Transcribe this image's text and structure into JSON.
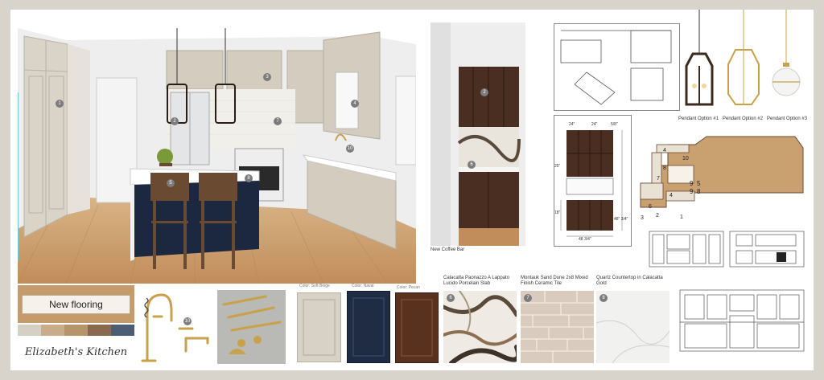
{
  "flooring_label": "New flooring",
  "signature": "Elizabeth's Kitchen",
  "coffee_bar_caption": "New Coffee Bar",
  "pendants": {
    "option1": "Pendant Option #1",
    "option2": "Pendant Option #2",
    "option3": "Pendant Option #3"
  },
  "color_labels": {
    "soft_beige": "Color: Soft Beige",
    "naval": "Color: Naval",
    "pecan": "Color: Pecan"
  },
  "materials": {
    "slab": "Calacatta Paonazzo A Lappato Lucido Porcelain Slab",
    "tile": "Montauk Sand Dune 2x8 Mixed Finish Ceramic Tile",
    "quartz": "Quartz Countertop in Calacatta Gold"
  },
  "callouts": {
    "c1": "1",
    "c2": "2",
    "c3": "3",
    "c4": "4",
    "c5": "5",
    "c6": "6",
    "c7": "7",
    "c8": "8",
    "c9": "9",
    "c10": "10",
    "s10": "10",
    "s6": "6",
    "s7": "7",
    "s8": "8",
    "cb2": "2",
    "cb6": "6"
  },
  "plan_numbers": {
    "n4a": "4",
    "n10": "10",
    "n8": "8",
    "n7": "7",
    "n4b": "4",
    "n9a": "9",
    "n5": "5",
    "n9b": "9",
    "n8b": "8",
    "n6": "6",
    "n2": "2",
    "n1": "1",
    "n3": "3"
  },
  "elevation_dims": {
    "d1": "24\"",
    "d2": "24\"",
    "d3": "5/8\"",
    "d4": "25\"",
    "d5": "18\"",
    "d6": "48\" 3/4\"",
    "d7": "48 3/4\""
  },
  "colors": {
    "soft_beige": "#d6cfc4",
    "naval": "#1f2c44",
    "pecan": "#5a3326",
    "wood_floor": "#c9a070",
    "gold": "#c8a24a"
  }
}
